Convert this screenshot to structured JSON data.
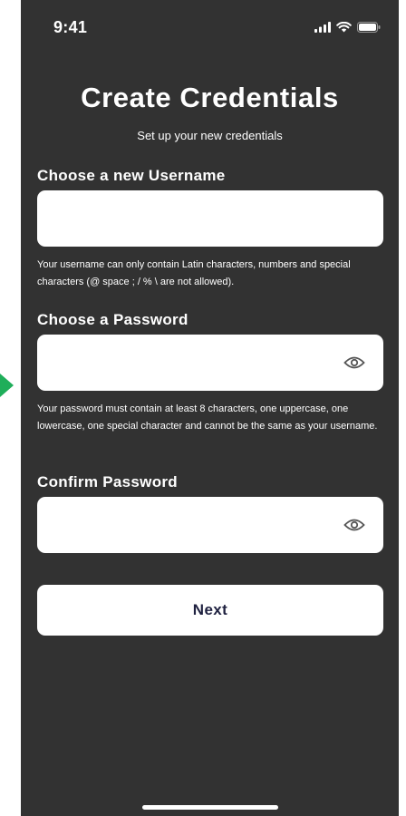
{
  "status_bar": {
    "time": "9:41",
    "icons": [
      "signal-icon",
      "wifi-icon",
      "battery-icon"
    ]
  },
  "header": {
    "title": "Create Credentials",
    "subtitle": "Set up your new credentials"
  },
  "username": {
    "label": "Choose a new Username",
    "value": "",
    "placeholder": "",
    "hint": "Your username can only contain Latin characters, numbers and special characters (@ space ; / % \\ are not allowed)."
  },
  "password": {
    "label": "Choose a Password",
    "value": "",
    "placeholder": "",
    "toggle_icon": "eye-icon",
    "hint": "Your password must contain at least 8 characters, one uppercase, one lowercase, one special character and cannot be the same as your username."
  },
  "confirm_password": {
    "label": "Confirm Password",
    "value": "",
    "placeholder": "",
    "toggle_icon": "eye-icon"
  },
  "actions": {
    "next_label": "Next"
  },
  "colors": {
    "background": "#323232",
    "surface": "#ffffff",
    "button_text": "#1f2140",
    "indicator_arrow": "#1fae5a"
  }
}
